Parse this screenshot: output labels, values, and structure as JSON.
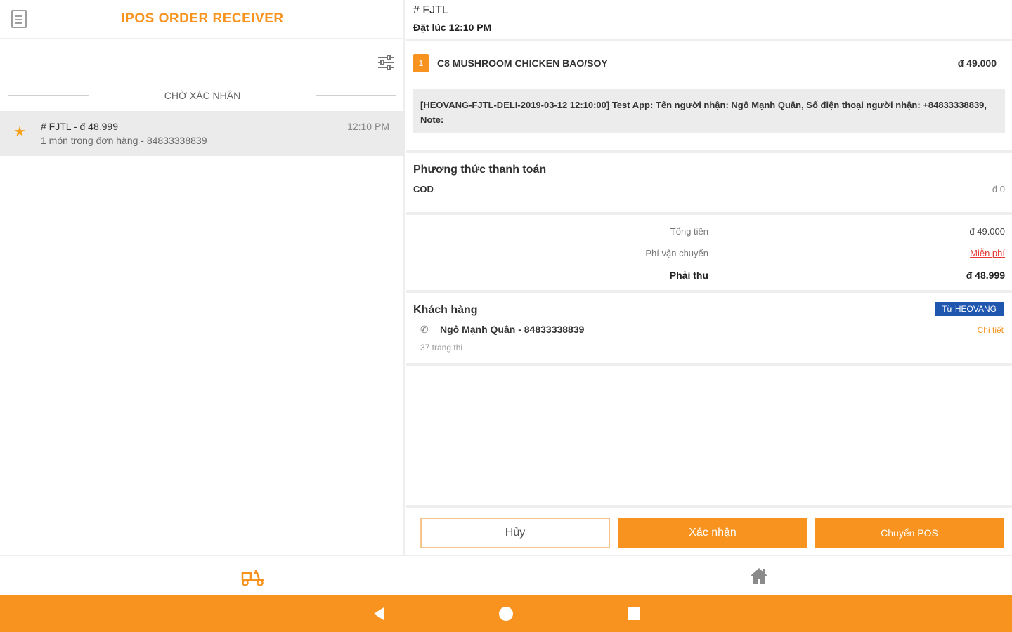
{
  "app": {
    "title": "IPOS ORDER RECEIVER"
  },
  "sidebar": {
    "section_label": "CHỜ XÁC NHẬN",
    "orders": [
      {
        "title": "# FJTL - đ 48.999",
        "subtitle": "1 món trong đơn hàng - 84833338839",
        "time": "12:10 PM",
        "starred": true
      }
    ]
  },
  "detail": {
    "order_code": "# FJTL",
    "order_time": "Đặt lúc 12:10 PM",
    "item": {
      "qty": "1",
      "name": "C8 MUSHROOM CHICKEN BAO/SOY",
      "price": "đ 49.000"
    },
    "note": "[HEOVANG-FJTL-DELI-2019-03-12 12:10:00] Test App: Tên người nhận: Ngô Mạnh Quân, Số điện thoại người nhận: +84833338839, Note:",
    "payment": {
      "title": "Phương thức thanh toán",
      "method": "COD",
      "amount": "đ 0"
    },
    "summary": {
      "total_label": "Tổng tiền",
      "total_value": "đ 49.000",
      "shipping_label": "Phí vận chuyển",
      "shipping_value": "Miễn phí",
      "due_label": "Phải thu",
      "due_value": "đ 48.999"
    },
    "customer": {
      "title": "Khách hàng",
      "source_badge": "Từ HEOVANG",
      "name_phone": "Ngô Mạnh Quân - 84833338839",
      "detail_link": "Chi tiết",
      "address": "37 tràng thi"
    },
    "actions": {
      "cancel": "Hủy",
      "confirm": "Xác nhận",
      "transfer": "Chuyển POS"
    }
  },
  "bottom_nav": {
    "items": [
      {
        "icon": "delivery-scooter-icon",
        "active": true
      },
      {
        "icon": "home-icon",
        "active": false
      }
    ]
  },
  "colors": {
    "accent": "#f7931e",
    "badge": "#1f56b0",
    "free": "#e53935"
  }
}
